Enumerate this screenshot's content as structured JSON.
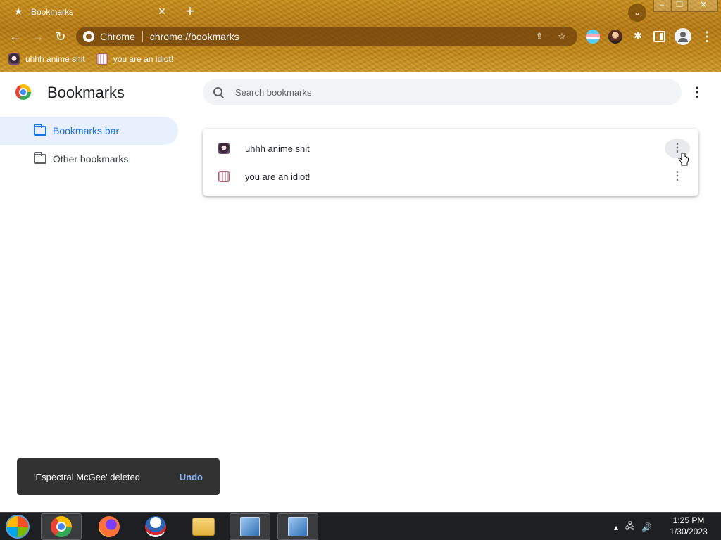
{
  "browser": {
    "tab_title": "Bookmarks",
    "omnibox_label": "Chrome",
    "url": "chrome://bookmarks",
    "theme_color": "#c48816"
  },
  "bookmarks_bar": [
    {
      "label": "uhhh anime shit",
      "icon": "anime-favicon"
    },
    {
      "label": "you are an idiot!",
      "icon": "idiot-favicon"
    }
  ],
  "page": {
    "title": "Bookmarks",
    "search_placeholder": "Search bookmarks",
    "accent_color": "#1a73e8"
  },
  "sidebar": {
    "items": [
      {
        "label": "Bookmarks bar",
        "active": true
      },
      {
        "label": "Other bookmarks",
        "active": false
      }
    ]
  },
  "list": {
    "items": [
      {
        "title": "uhhh anime shit",
        "icon": "anime-favicon"
      },
      {
        "title": "you are an idiot!",
        "icon": "idiot-favicon"
      }
    ]
  },
  "toast": {
    "message": "'Espectral McGee' deleted",
    "action": "Undo"
  },
  "taskbar": {
    "time": "1:25 PM",
    "date": "1/30/2023"
  }
}
